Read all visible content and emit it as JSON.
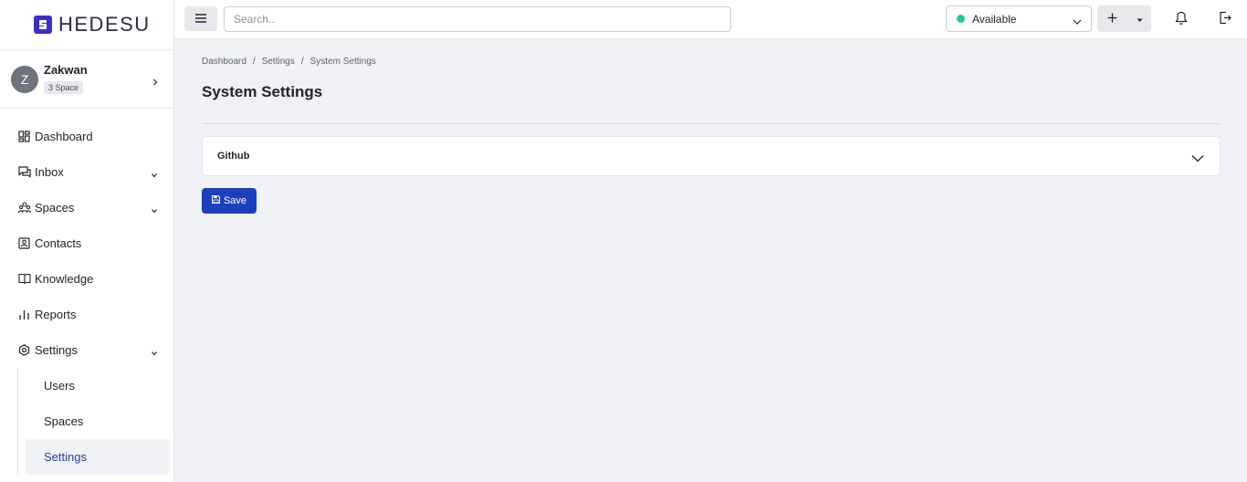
{
  "brand": {
    "name": "HEDESU",
    "logo_icon": "hedesu-logo-icon",
    "accent": "#3b2fc9"
  },
  "user": {
    "initial": "Z",
    "name": "Zakwan",
    "badge": "3 Space"
  },
  "sidebar": {
    "items": [
      {
        "label": "Dashboard",
        "icon": "dashboard-icon"
      },
      {
        "label": "Inbox",
        "icon": "inbox-icon",
        "expandable": true
      },
      {
        "label": "Spaces",
        "icon": "spaces-icon",
        "expandable": true
      },
      {
        "label": "Contacts",
        "icon": "contacts-icon"
      },
      {
        "label": "Knowledge",
        "icon": "book-icon"
      },
      {
        "label": "Reports",
        "icon": "reports-icon"
      },
      {
        "label": "Settings",
        "icon": "settings-icon",
        "expandable": true,
        "expanded": true
      }
    ],
    "settings_sub": [
      {
        "label": "Users"
      },
      {
        "label": "Spaces"
      },
      {
        "label": "Settings",
        "active": true
      }
    ]
  },
  "topbar": {
    "search_placeholder": "Search..",
    "status": {
      "label": "Available",
      "color": "#20c997"
    }
  },
  "main": {
    "breadcrumb": [
      "Dashboard",
      "Settings",
      "System Settings"
    ],
    "breadcrumb_sep": "/",
    "title": "System Settings",
    "accordion": {
      "title": "Github",
      "expanded": false
    },
    "save_label": "Save",
    "save_color": "#1d3fbf"
  }
}
